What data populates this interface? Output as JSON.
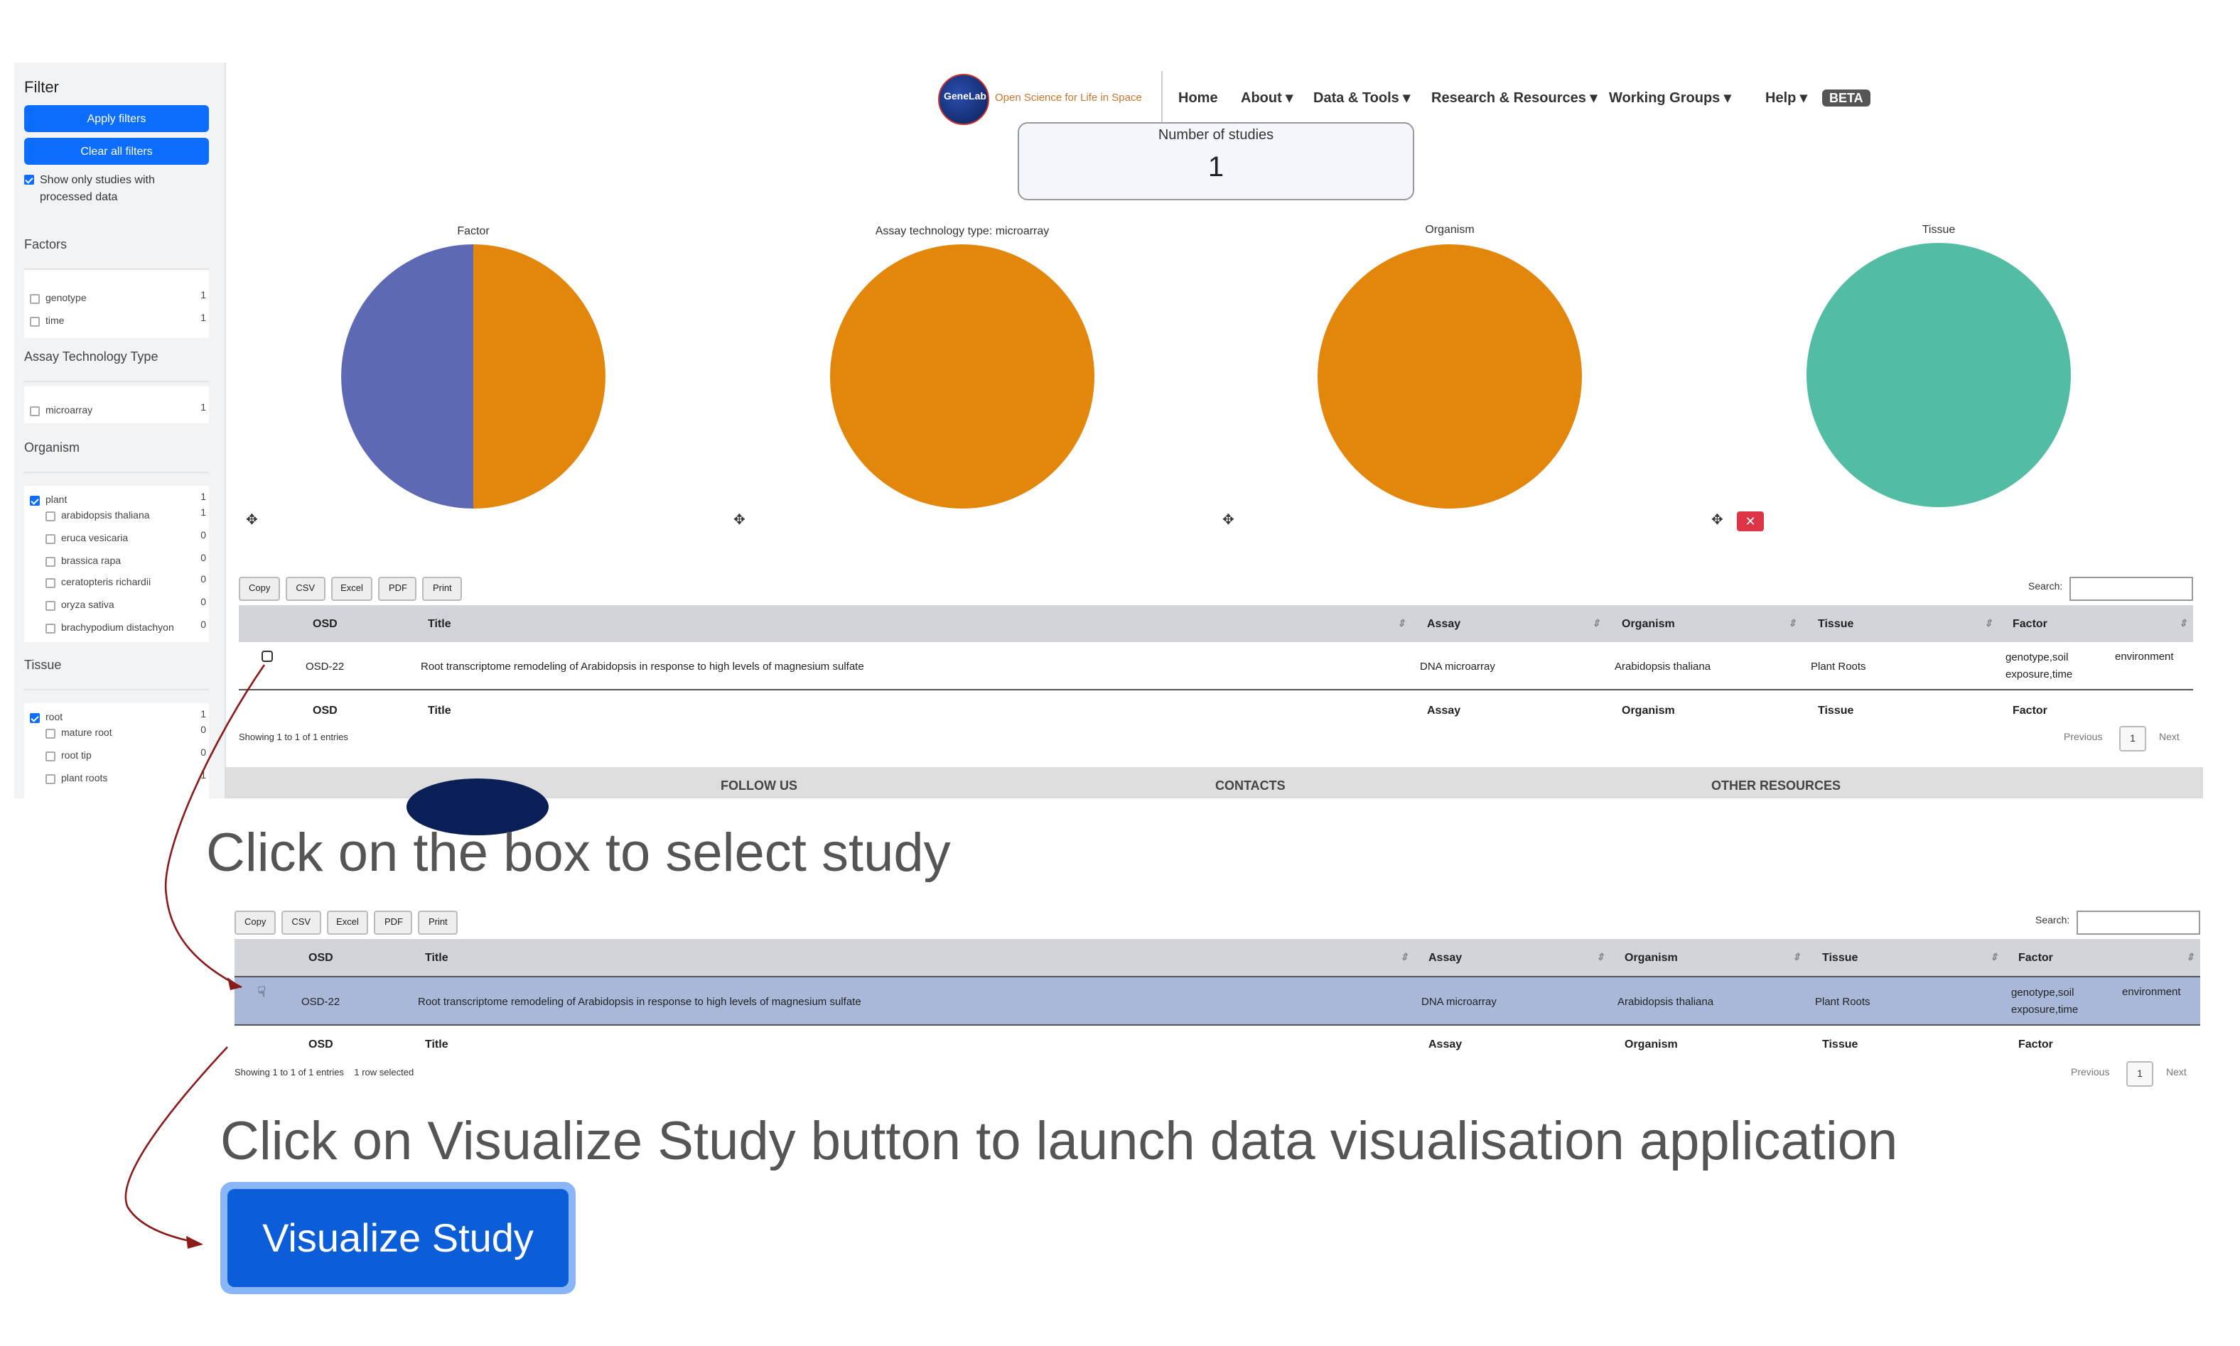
{
  "sidebar": {
    "title": "Filter",
    "apply_label": "Apply filters",
    "clear_label": "Clear all filters",
    "processed_label": "Show only studies with processed data",
    "sections": {
      "factors": {
        "title": "Factors",
        "items": [
          {
            "label": "genotype",
            "count": "1"
          },
          {
            "label": "time",
            "count": "1"
          }
        ]
      },
      "assay": {
        "title": "Assay Technology Type",
        "items": [
          {
            "label": "microarray",
            "count": "1"
          }
        ]
      },
      "organism": {
        "title": "Organism",
        "items": [
          {
            "label": "plant",
            "count": "1"
          },
          {
            "label": "arabidopsis thaliana",
            "count": "1"
          },
          {
            "label": "eruca vesicaria",
            "count": "0"
          },
          {
            "label": "brassica rapa",
            "count": "0"
          },
          {
            "label": "ceratopteris richardii",
            "count": "0"
          },
          {
            "label": "oryza sativa",
            "count": "0"
          },
          {
            "label": "brachypodium distachyon",
            "count": "0"
          }
        ]
      },
      "tissue": {
        "title": "Tissue",
        "items": [
          {
            "label": "root",
            "count": "1"
          },
          {
            "label": "mature root",
            "count": "0"
          },
          {
            "label": "root tip",
            "count": "0"
          },
          {
            "label": "plant roots",
            "count": "1"
          }
        ]
      }
    }
  },
  "nav": {
    "logo_text": "GeneLab",
    "tagline": "Open Science for Life in Space",
    "items": [
      "Home",
      "About ▾",
      "Data & Tools ▾",
      "Research & Resources ▾",
      "Working Groups ▾",
      "Help ▾"
    ],
    "beta": "BETA"
  },
  "studies": {
    "label": "Number of studies",
    "value": "1"
  },
  "charts": {
    "colors": {
      "orange": "#e3860c",
      "purple": "#5e69b3",
      "teal": "#52bda4"
    },
    "chart_data": [
      {
        "type": "pie",
        "title": "Factor",
        "slices": [
          {
            "value": 1,
            "color": "#e3860c"
          },
          {
            "value": 1,
            "color": "#5e69b3"
          }
        ]
      },
      {
        "type": "pie",
        "title": "Assay technology type: microarray",
        "slices": [
          {
            "value": 1,
            "color": "#e3860c"
          }
        ]
      },
      {
        "type": "pie",
        "title": "Organism",
        "slices": [
          {
            "value": 1,
            "color": "#e3860c"
          }
        ]
      },
      {
        "type": "pie",
        "title": "Tissue",
        "slices": [
          {
            "value": 1,
            "color": "#52bda4"
          }
        ]
      }
    ],
    "move_icon": "✥",
    "close_icon": "✕"
  },
  "table": {
    "buttons": [
      "Copy",
      "CSV",
      "Excel",
      "PDF",
      "Print"
    ],
    "search_label": "Search:",
    "columns": [
      "OSD",
      "Title",
      "Assay",
      "Organism",
      "Tissue",
      "Factor"
    ],
    "row": {
      "osd": "OSD-22",
      "title": "Root transcriptome remodeling of Arabidopsis in response to high levels of magnesium sulfate",
      "assay": "DNA microarray",
      "organism": "Arabidopsis thaliana",
      "tissue": "Plant Roots",
      "factor": "genotype,soil exposure,time",
      "factor_extra": "environment"
    },
    "info": "Showing 1 to 1 of 1 entries",
    "info_selected": "Showing 1 to 1 of 1 entries    1 row selected",
    "previous": "Previous",
    "page": "1",
    "next": "Next"
  },
  "footer": {
    "follow": "FOLLOW US",
    "contacts": "CONTACTS",
    "other": "OTHER RESOURCES"
  },
  "captions": {
    "select": "Click on the box to select study",
    "visualize": "Click on Visualize Study button to launch data visualisation application"
  },
  "visualize_button": "Visualize Study",
  "arrow_color": "#8b1a1a",
  "selected_row_color": "#a9b8d8"
}
